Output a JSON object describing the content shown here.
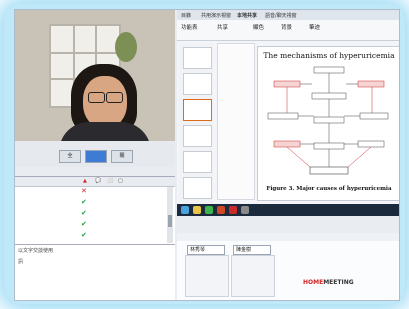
{
  "video_panel": {
    "buttons": [
      "全",
      "",
      "關"
    ]
  },
  "participant_grid": {
    "headers": [
      "",
      "▲",
      "💬",
      "⬜",
      "▢"
    ],
    "rows": [
      {
        "name": "",
        "status": "✕"
      },
      {
        "name": "",
        "status": "✔"
      },
      {
        "name": "",
        "status": "✔"
      },
      {
        "name": "",
        "status": "✔"
      },
      {
        "name": "",
        "status": "✔"
      }
    ]
  },
  "chat": {
    "lines": [
      "以文字交談使用",
      "訊"
    ]
  },
  "presentation_app": {
    "tabs": [
      "目錄",
      "共用演示視窗",
      "本地共享",
      "語音/聊天視窗"
    ],
    "ribbon": [
      "功能表",
      "共享",
      "顯色",
      "背景",
      "筆迹"
    ],
    "slide": {
      "title": "The mechanisms of hyperuricemia",
      "caption": "Figure 3. Major causes of hyperuricemia"
    }
  },
  "lower_panel": {
    "combos": [
      "林秀琴",
      "陳金樹"
    ],
    "logo_prefix": "HOME",
    "logo_suffix": "MEETING"
  },
  "colors": {
    "glow": "#bfe8f8",
    "accent_red": "#c92a2a",
    "check_green": "#1ea23c"
  }
}
